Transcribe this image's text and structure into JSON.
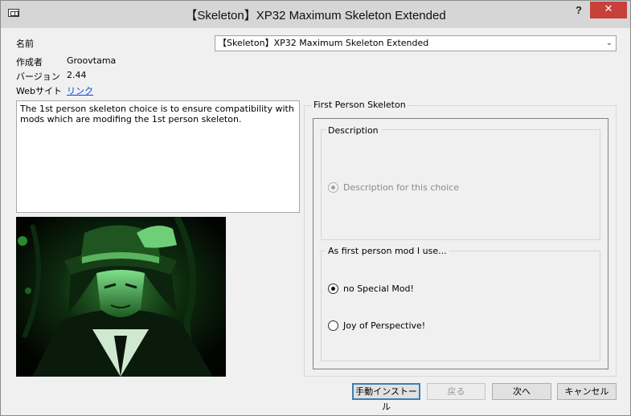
{
  "window": {
    "title": "【Skeleton】XP32 Maximum Skeleton Extended",
    "help_label": "?",
    "close_label": "✕"
  },
  "info": {
    "name_label": "名前",
    "author_label": "作成者",
    "author_value": "Groovtama",
    "version_label": "バージョン",
    "version_value": "2.44",
    "website_label": "Webサイト",
    "website_link": "リンク"
  },
  "plugin_select": {
    "value": "【Skeleton】XP32 Maximum Skeleton Extended"
  },
  "description_text": "The 1st person skeleton choice is to ensure compatibility with\nmods which are modifing the 1st person skeleton.",
  "right_panel": {
    "title": "First Person Skeleton",
    "description_group": {
      "title": "Description",
      "option_label": "Description for this choice"
    },
    "mod_group": {
      "title": "As first person mod I use...",
      "options": [
        {
          "label": "no Special Mod!",
          "selected": true
        },
        {
          "label": "Joy of Perspective!",
          "selected": false
        }
      ]
    }
  },
  "buttons": {
    "manual_install": "手動インストール",
    "back": "戻る",
    "next": "次へ",
    "cancel": "キャンセル"
  }
}
